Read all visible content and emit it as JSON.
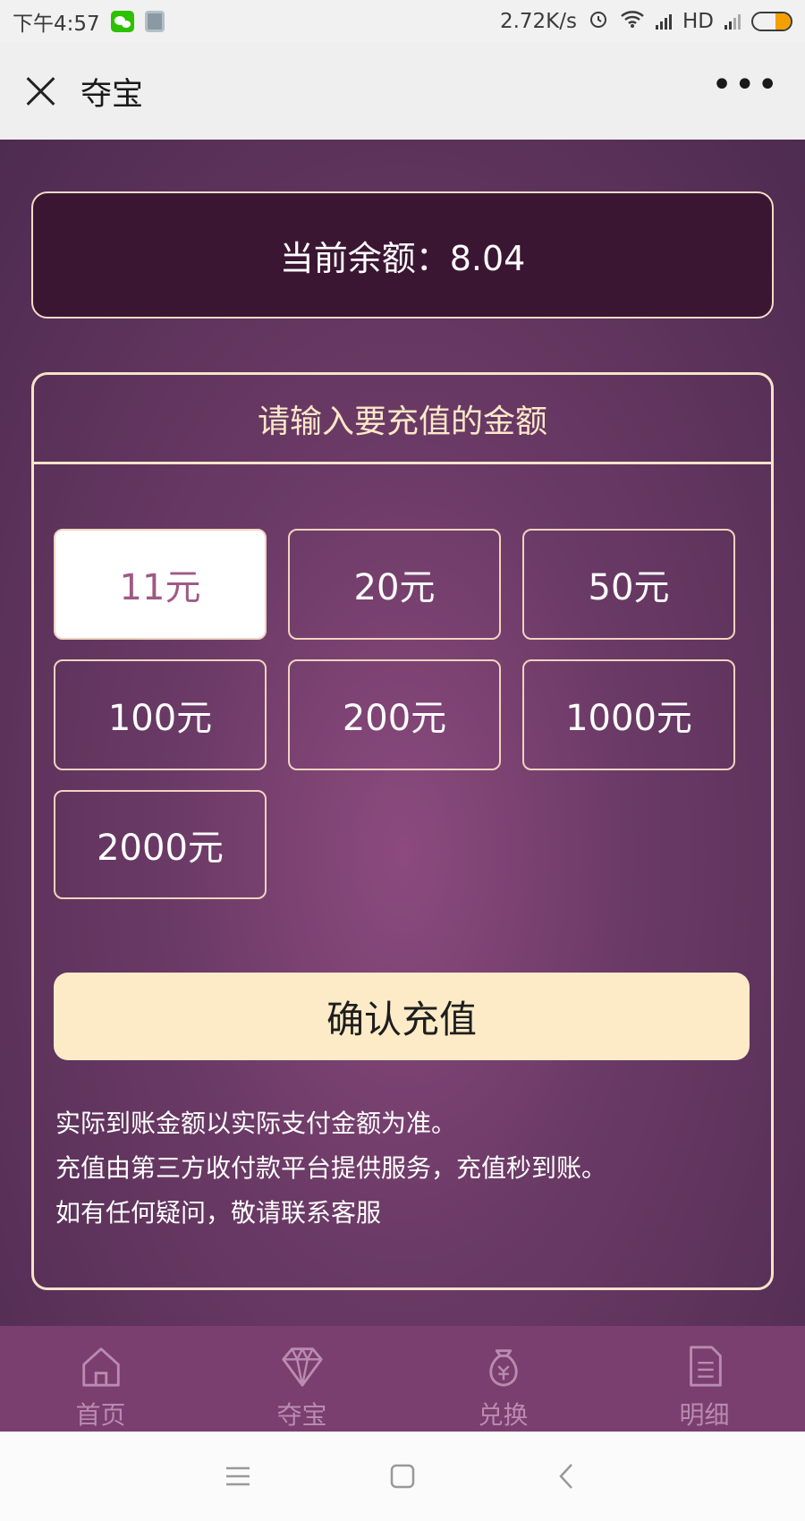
{
  "status_bar": {
    "time": "下午4:57",
    "network_speed": "2.72K/s",
    "network_type": "HD"
  },
  "title_bar": {
    "title": "夺宝",
    "more": "•••"
  },
  "balance": {
    "label": "当前余额：8.04"
  },
  "recharge": {
    "header": "请输入要充值的金额",
    "amounts": [
      "11元",
      "20元",
      "50元",
      "100元",
      "200元",
      "1000元",
      "2000元"
    ],
    "selected_index": 0,
    "confirm_label": "确认充值",
    "notes": [
      "实际到账金额以实际支付金额为准。",
      "充值由第三方收付款平台提供服务，充值秒到账。",
      "如有任何疑问，敬请联系客服"
    ]
  },
  "bottom_nav": {
    "items": [
      {
        "label": "首页",
        "icon": "home-icon"
      },
      {
        "label": "夺宝",
        "icon": "diamond-icon"
      },
      {
        "label": "兑换",
        "icon": "money-bag-icon"
      },
      {
        "label": "明细",
        "icon": "document-icon"
      }
    ]
  },
  "colors": {
    "panel_border": "#f7e3c9",
    "confirm_bg": "#fdebc8",
    "selected_text": "#9d5b84",
    "nav_bg": "#7a3e6f"
  }
}
